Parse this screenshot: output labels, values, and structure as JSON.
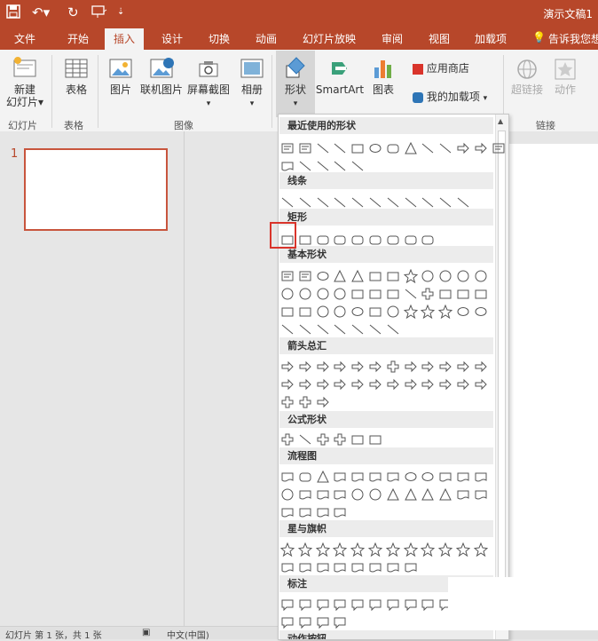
{
  "titlebar": {
    "doc_title": "演示文稿1"
  },
  "tabs": [
    "文件",
    "开始",
    "插入",
    "设计",
    "切换",
    "动画",
    "幻灯片放映",
    "审阅",
    "视图",
    "加载项",
    "告诉我您想"
  ],
  "ribbon": {
    "new_slide": "新建\n幻灯片",
    "new_slide_arrow": "▾",
    "table": "表格",
    "picture": "图片",
    "online_picture": "联机图片",
    "screenshot": "屏幕截图",
    "album": "相册",
    "shapes": "形状",
    "smartart": "SmartArt",
    "chart": "图表",
    "store": "应用商店",
    "my_addins": "我的加载项",
    "hyperlink": "超链接",
    "action": "动作",
    "groups": {
      "slides": "幻灯片",
      "tables": "表格",
      "images": "图像",
      "links": "链接"
    }
  },
  "thumbpane": {
    "slide_number": "1"
  },
  "gallery": {
    "sections": [
      "最近使用的形状",
      "线条",
      "矩形",
      "基本形状",
      "箭头总汇",
      "公式形状",
      "流程图",
      "星与旗帜",
      "标注",
      "动作按钮"
    ]
  },
  "statusbar": {
    "slide_info": "幻灯片 第 1 张，共 1 张",
    "language": "中文(中国)"
  },
  "colors": {
    "accent": "#b7472a",
    "highlight": "#d9342b"
  }
}
